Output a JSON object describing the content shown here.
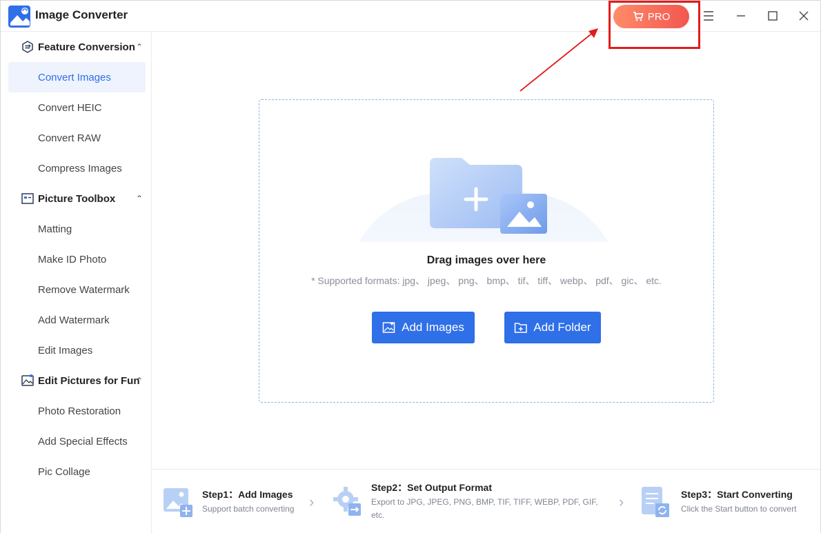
{
  "app": {
    "title": "Image Converter",
    "pro_label": "PRO",
    "accent": "#2f6fe8",
    "pro_gradient": [
      "#ff8b6a",
      "#f2574f"
    ],
    "highlight_color": "#e21b1b"
  },
  "window_controls": [
    "menu-icon",
    "minimize-icon",
    "maximize-icon",
    "close-icon"
  ],
  "sidebar": {
    "groups": [
      {
        "label": "Feature Conversion",
        "icon": "convert-icon",
        "items": [
          "Convert Images",
          "Convert HEIC",
          "Convert RAW",
          "Compress Images"
        ]
      },
      {
        "label": "Picture Toolbox",
        "icon": "toolbox-icon",
        "items": [
          "Matting",
          "Make ID Photo",
          "Remove Watermark",
          "Add Watermark",
          "Edit Images"
        ]
      },
      {
        "label": "Edit Pictures for Fun",
        "icon": "fun-picture-icon",
        "items": [
          "Photo Restoration",
          "Add Special Effects",
          "Pic Collage"
        ]
      }
    ],
    "active_item": "Convert Images"
  },
  "dropzone": {
    "title": "Drag images over here",
    "formats": "* Supported formats: jpg、 jpeg、 png、 bmp、 tif、 tiff、 webp、 pdf、 gic、 etc.",
    "add_images_label": "Add Images",
    "add_folder_label": "Add Folder"
  },
  "steps": [
    {
      "title": "Step1：Add Images",
      "desc": "Support batch converting"
    },
    {
      "title": "Step2：Set Output Format",
      "desc": "Export to JPG, JPEG, PNG, BMP, TIF, TIFF, WEBP, PDF, GIF, etc."
    },
    {
      "title": "Step3：Start Converting",
      "desc": "Click the Start button to convert"
    }
  ]
}
